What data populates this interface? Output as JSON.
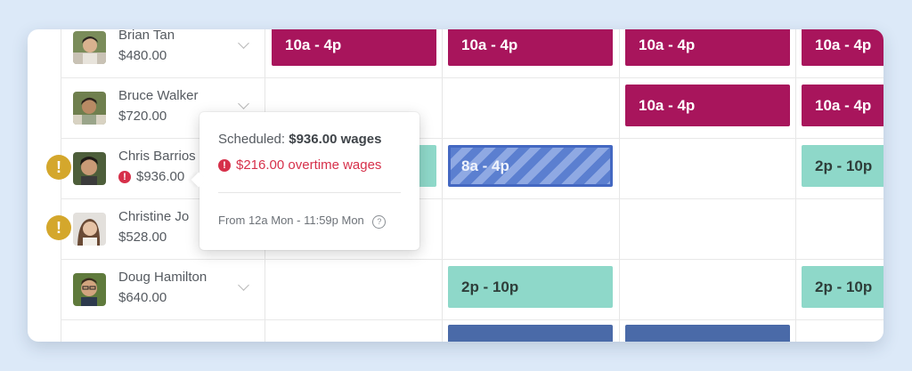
{
  "employees": [
    {
      "name": "Brian Tan",
      "wage": "$480.00",
      "warning": false
    },
    {
      "name": "Bruce Walker",
      "wage": "$720.00",
      "warning": false
    },
    {
      "name": "Chris Barrios",
      "wage": "$936.00",
      "warning": true
    },
    {
      "name": "Christine Jo",
      "wage": "$528.00",
      "warning": true
    },
    {
      "name": "Doug Hamilton",
      "wage": "$640.00",
      "warning": false
    }
  ],
  "shifts": {
    "brian": [
      "10a - 4p",
      "10a - 4p",
      "10a - 4p",
      "10a - 4p"
    ],
    "bruce": [
      "10a - 4p",
      "10a - 4p"
    ],
    "chris": [
      "8a - 4p",
      "2p - 10p"
    ],
    "doug": [
      "2p - 10p",
      "2p - 10p"
    ]
  },
  "tooltip": {
    "scheduled_label": "Scheduled:",
    "scheduled_value": "$936.00 wages",
    "overtime": "$216.00 overtime wages",
    "range": "From 12a Mon - 11:59p Mon"
  },
  "icons": {
    "warning": "exclamation-circle",
    "chevron": "chevron-down",
    "help": "question-circle"
  },
  "colors": {
    "magenta_shift": "#a8155c",
    "teal_shift": "#8ed8c9",
    "overtime_red": "#d6304a",
    "warning_gold": "#d4a72c",
    "selected_shift_blue": "#5b7fd0"
  }
}
